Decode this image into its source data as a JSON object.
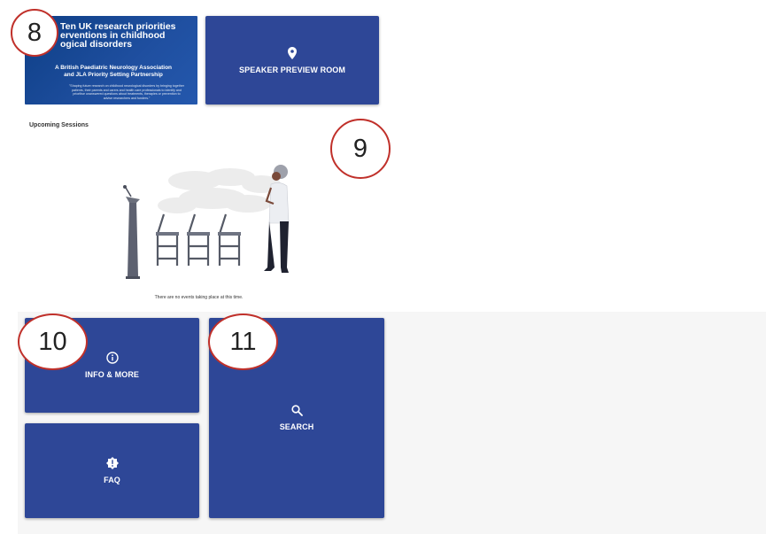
{
  "banner": {
    "title": "Ten UK research priorities… interventions in childhood… neurological disorders",
    "title_line1": "Ten UK research priorities",
    "title_line2": "erventions in childhood",
    "title_line3": "ogical disorders",
    "subtitle_line1": "A British Paediatric Neurology Association",
    "subtitle_line2": "and JLA Priority Setting Partnership",
    "quote": "\"Shaping future research on childhood neurological disorders by bringing together patients, their parents and carers and health care professionals to identify and prioritise unanswered questions about treatments, therapies or prevention to advise researchers and funders.\""
  },
  "speaker_tile": {
    "label": "SPEAKER PREVIEW ROOM",
    "icon": "map-pin-icon"
  },
  "sessions": {
    "title": "Upcoming Sessions",
    "empty_message": "There are no events taking place at this time."
  },
  "info_tile": {
    "label": "INFO & MORE",
    "icon": "info-circle-icon"
  },
  "faq_tile": {
    "label": "FAQ",
    "icon": "alert-badge-icon"
  },
  "search_tile": {
    "label": "SEARCH",
    "icon": "search-icon"
  },
  "markers": [
    "8",
    "9",
    "10",
    "11"
  ],
  "colors": {
    "tile": "#2e4797",
    "marker_border": "#c0302a",
    "grey_bg": "#f6f6f6"
  }
}
